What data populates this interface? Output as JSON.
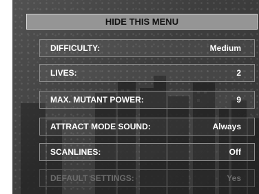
{
  "menu": {
    "hide_label": "HIDE THIS MENU",
    "items": [
      {
        "label": "DIFFICULTY:",
        "value": "Medium",
        "enabled": true
      },
      {
        "label": "LIVES:",
        "value": "2",
        "enabled": true
      },
      {
        "label": "MAX. MUTANT POWER:",
        "value": "9",
        "enabled": true
      },
      {
        "label": "ATTRACT MODE SOUND:",
        "value": "Always",
        "enabled": true
      },
      {
        "label": "SCANLINES:",
        "value": "Off",
        "enabled": true
      },
      {
        "label": "DEFAULT SETTINGS:",
        "value": "Yes",
        "enabled": false
      }
    ]
  },
  "colors": {
    "background": "#3e3e3e",
    "button": "#959595",
    "row_border": "#8c8c8c",
    "text": "#ffffff",
    "disabled_text": "#6c6c6c"
  }
}
